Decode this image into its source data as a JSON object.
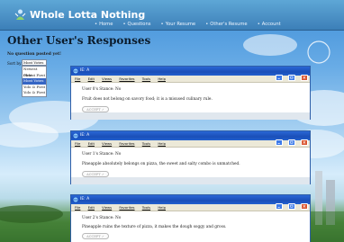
{
  "site": {
    "title": "Whole Lotta Nothing",
    "nav": [
      "Home",
      "Questions",
      "Your Resume",
      "Other's Resume",
      "Account"
    ]
  },
  "page": {
    "heading": "Other User's Responses",
    "no_question_text": "No question posted yet!",
    "sort_label": "Sort by:",
    "sort_selected": "Most Votes",
    "sort_options": [
      "Newest First",
      "Oldest First",
      "Most Votes",
      "Yolo & First",
      "Yolo & First"
    ],
    "sort_highlighted_index": 2
  },
  "windows": [
    {
      "title": "IE: A",
      "menu": [
        "File",
        "Edit",
        "Views",
        "Favorites",
        "Tools",
        "Help"
      ],
      "user_line": "User 0's Stance: No",
      "answer": "Fruit does not belong on savory food; it is a misused culinary rule.",
      "accept_label": "ACCEPT ✓"
    },
    {
      "title": "IE: A",
      "menu": [
        "File",
        "Edit",
        "Views",
        "Favorites",
        "Tools",
        "Help"
      ],
      "user_line": "User 1's Stance: No",
      "answer": "Pineapple absolutely belongs on pizza, the sweet and salty combo is unmatched.",
      "accept_label": "ACCEPT ✓"
    },
    {
      "title": "IE: A",
      "menu": [
        "File",
        "Edit",
        "Views",
        "Favorites",
        "Tools",
        "Help"
      ],
      "user_line": "User 2's Stance: No",
      "answer": "Pineapple ruins the texture of pizza, it makes the dough soggy and gross.",
      "accept_label": "ACCEPT ✓"
    }
  ]
}
